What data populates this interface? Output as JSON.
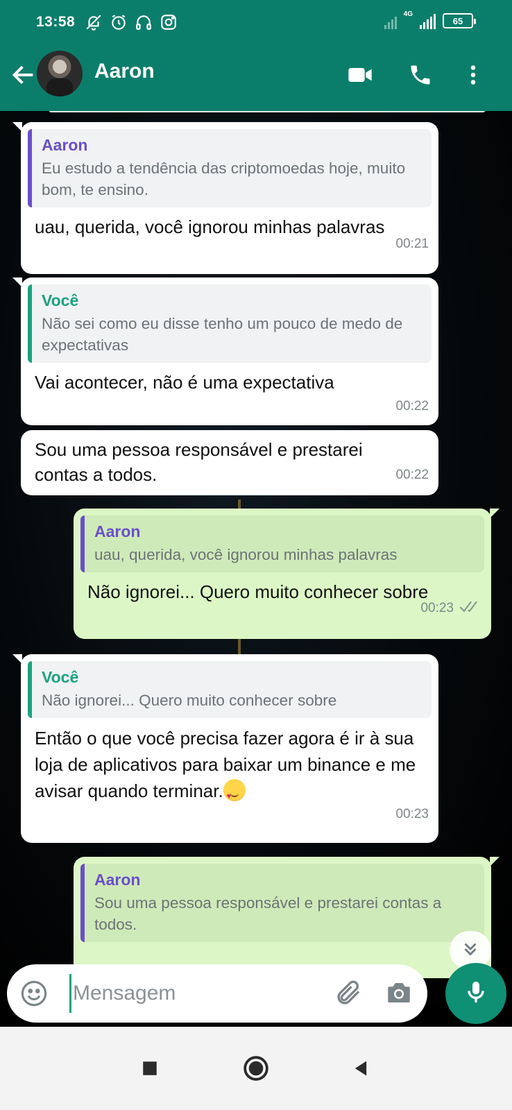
{
  "status_bar": {
    "time": "13:58",
    "network": "4G",
    "battery": "65",
    "icons": [
      "mute-bell-icon",
      "alarm-icon",
      "headset-icon",
      "instagram-icon"
    ]
  },
  "header": {
    "contact_name": "Aaron",
    "icons": [
      "back-arrow-icon",
      "video-call-icon",
      "phone-icon",
      "more-options-icon"
    ]
  },
  "messages": [
    {
      "direction": "in",
      "quote": {
        "author": "Aaron",
        "text": "Eu estudo a tendência das criptomoedas hoje, muito bom, te ensino."
      },
      "text": "uau, querida, você ignorou minhas palavras",
      "time": "00:21"
    },
    {
      "direction": "in",
      "quote": {
        "author": "Você",
        "text": "Não sei como eu disse tenho um pouco de medo de expectativas"
      },
      "text": "Vai acontecer, não é uma expectativa",
      "time": "00:22"
    },
    {
      "direction": "in",
      "text": "Sou uma pessoa responsável e prestarei contas a todos.",
      "time": "00:22"
    },
    {
      "direction": "out",
      "quote": {
        "author": "Aaron",
        "text": "uau, querida, você ignorou minhas palavras"
      },
      "text": "Não ignorei... Quero muito conhecer sobre",
      "time": "00:23",
      "status": "read"
    },
    {
      "direction": "in",
      "quote": {
        "author": "Você",
        "text": "Não ignorei... Quero muito conhecer sobre"
      },
      "text": "Então o que você precisa fazer agora é ir à sua loja de aplicativos para baixar um binance e me avisar quando terminar.",
      "emoji": "smiling-face-with-hearts",
      "time": "00:23"
    },
    {
      "direction": "out",
      "quote": {
        "author": "Aaron",
        "text": "Sou uma pessoa responsável e prestarei contas a todos."
      },
      "text": ""
    }
  ],
  "composer": {
    "placeholder": "Mensagem",
    "icons": [
      "emoji-icon",
      "attach-icon",
      "camera-icon",
      "mic-icon"
    ]
  },
  "colors": {
    "header_bg": "#0b7e6b",
    "incoming_bubble": "#ffffff",
    "outgoing_bubble": "#dcf7c5",
    "quote_author_purple": "#6a4fc9",
    "quote_author_green": "#1aa37e",
    "mic_button": "#0f8f74"
  }
}
